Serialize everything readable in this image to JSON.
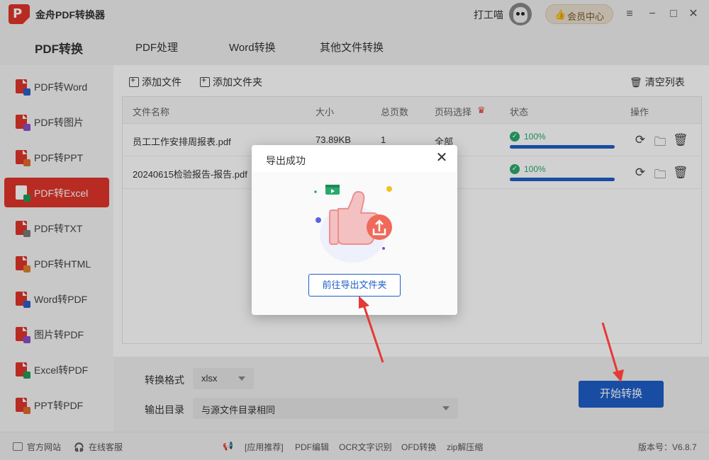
{
  "app": {
    "title": "金舟PDF转换器",
    "logo_letter": "P"
  },
  "user": {
    "name": "打工喵"
  },
  "vip": {
    "label": "会员中心"
  },
  "window_controls": {
    "menu": "≡",
    "minimize": "−",
    "maximize": "□",
    "close": "✕"
  },
  "topnav": {
    "tabs": [
      "PDF转换",
      "PDF处理",
      "Word转换",
      "其他文件转换"
    ],
    "active": 0
  },
  "sidebar": {
    "items": [
      {
        "label": "PDF转Word",
        "badge_color": "#2b5fc7"
      },
      {
        "label": "PDF转图片",
        "badge_color": "#8a4fc9"
      },
      {
        "label": "PDF转PPT",
        "badge_color": "#e06b2b"
      },
      {
        "label": "PDF转Excel",
        "badge_color": "#1e9c5a"
      },
      {
        "label": "PDF转TXT",
        "badge_color": "#7a7a7a"
      },
      {
        "label": "PDF转HTML",
        "badge_color": "#e0802b"
      },
      {
        "label": "Word转PDF",
        "badge_color": "#2b5fc7"
      },
      {
        "label": "图片转PDF",
        "badge_color": "#8a4fc9"
      },
      {
        "label": "Excel转PDF",
        "badge_color": "#1e9c5a"
      },
      {
        "label": "PPT转PDF",
        "badge_color": "#e06b2b"
      }
    ],
    "active": 3
  },
  "toolbar": {
    "add_file": "添加文件",
    "add_folder": "添加文件夹",
    "clear_list": "清空列表"
  },
  "table": {
    "headers": {
      "name": "文件名称",
      "size": "大小",
      "pages": "总页数",
      "page_select": "页码选择",
      "status": "状态",
      "ops": "操作"
    },
    "rows": [
      {
        "name": "员工工作安排周报表.pdf",
        "size": "73.89KB",
        "pages": "1",
        "page_select": "全部",
        "status": "100%",
        "progress": 1.0
      },
      {
        "name": "20240615检验报告-报告.pdf",
        "size": "",
        "pages": "",
        "page_select": "",
        "status": "100%",
        "progress": 1.0
      }
    ]
  },
  "settings": {
    "format_label": "转换格式",
    "format_value": "xlsx",
    "output_label": "输出目录",
    "output_value": "与源文件目录相同",
    "start_button": "开始转换"
  },
  "footer": {
    "website": "官方网站",
    "support": "在线客服",
    "recommend": "[应用推荐]",
    "links": [
      "PDF编辑",
      "OCR文字识别",
      "OFD转换",
      "zip解压缩"
    ],
    "version": "版本号：V6.8.7"
  },
  "modal": {
    "title": "导出成功",
    "button": "前往导出文件夹",
    "close_glyph": "✕"
  },
  "colors": {
    "brand_red": "#e0352b",
    "primary_blue": "#1e5fc7",
    "success_green": "#2aa96b",
    "annotation_red": "#e53935"
  }
}
